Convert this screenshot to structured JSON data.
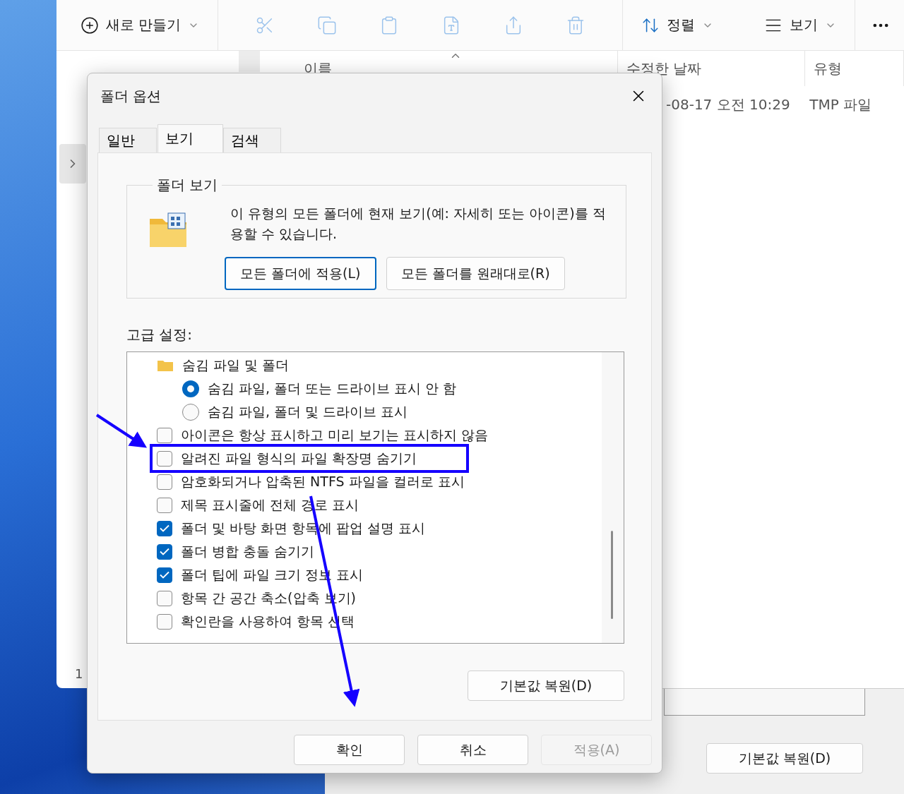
{
  "explorer": {
    "toolbar": {
      "new_label": "새로 만들기",
      "sort_label": "정렬",
      "view_label": "보기"
    },
    "columns": [
      "이름",
      "수정한 날짜",
      "유형"
    ],
    "row": {
      "date": "-08-17 오전 10:29",
      "type": "TMP 파일"
    },
    "status": "1"
  },
  "back_window": {
    "restore_button": "기본값 복원(D)"
  },
  "dialog": {
    "title": "폴더 옵션",
    "tabs": [
      {
        "label": "일반",
        "selected": false
      },
      {
        "label": "보기",
        "selected": true
      },
      {
        "label": "검색",
        "selected": false
      }
    ],
    "folder_view": {
      "title": "폴더 보기",
      "description": "이 유형의 모든 폴더에 현재 보기(예: 자세히 또는 아이콘)를 적용할 수 있습니다.",
      "buttons": [
        {
          "label": "모든 폴더에 적용(L)",
          "focused": true
        },
        {
          "label": "모든 폴더를 원래대로(R)",
          "focused": false
        }
      ]
    },
    "advanced_label": "고급 설정:",
    "settings": [
      {
        "kind": "folder",
        "label": "숨김 파일 및 폴더",
        "children": [
          {
            "kind": "radio",
            "label": "숨김 파일, 폴더 또는 드라이브 표시 안 함",
            "selected": true
          },
          {
            "kind": "radio",
            "label": "숨김 파일, 폴더 및 드라이브 표시",
            "selected": false
          }
        ]
      },
      {
        "kind": "checkbox",
        "label": "아이콘은 항상 표시하고 미리 보기는 표시하지 않음",
        "checked": false,
        "highlighted": false
      },
      {
        "kind": "checkbox",
        "label": "알려진 파일 형식의 파일 확장명 숨기기",
        "checked": false,
        "highlighted": true
      },
      {
        "kind": "checkbox",
        "label": "암호화되거나 압축된 NTFS 파일을 컬러로 표시",
        "checked": false,
        "highlighted": false
      },
      {
        "kind": "checkbox",
        "label": "제목 표시줄에 전체 경로 표시",
        "checked": false,
        "highlighted": false
      },
      {
        "kind": "checkbox",
        "label": "폴더 및 바탕 화면 항목에 팝업 설명 표시",
        "checked": true,
        "highlighted": false
      },
      {
        "kind": "checkbox",
        "label": "폴더 병합 충돌 숨기기",
        "checked": true,
        "highlighted": false
      },
      {
        "kind": "checkbox",
        "label": "폴더 팁에 파일 크기 정보 표시",
        "checked": true,
        "highlighted": false
      },
      {
        "kind": "checkbox",
        "label": "항목 간 공간 축소(압축 보기)",
        "checked": false,
        "highlighted": false
      },
      {
        "kind": "checkbox",
        "label": "확인란을 사용하여 항목 선택",
        "checked": false,
        "highlighted": false
      }
    ],
    "restore_button": "기본값 복원(D)",
    "footer_buttons": [
      {
        "label": "확인",
        "disabled": false
      },
      {
        "label": "취소",
        "disabled": false
      },
      {
        "label": "적용(A)",
        "disabled": true
      }
    ]
  }
}
